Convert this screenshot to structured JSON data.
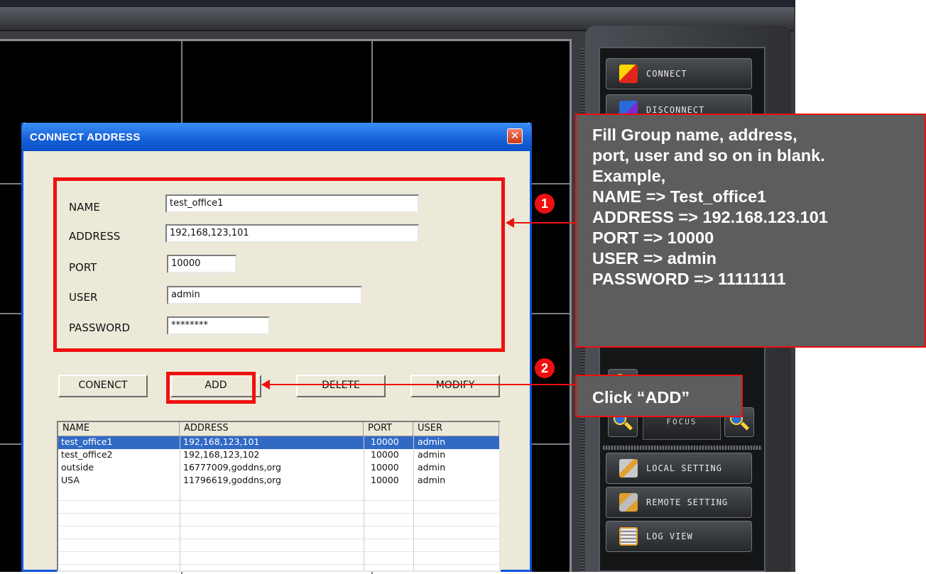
{
  "sidebar": {
    "connect_label": "CONNECT",
    "disconnect_label": "DISCONNECT",
    "focus_label": "FOCUS",
    "local_setting_label": "LOCAL SETTING",
    "remote_setting_label": "REMOTE SETTING",
    "log_view_label": "LOG VIEW"
  },
  "dialog": {
    "title": "CONNECT ADDRESS",
    "close_glyph": "✕",
    "fields": {
      "name_label": "NAME",
      "name_value": "test_office1",
      "address_label": "ADDRESS",
      "address_value": "192,168,123,101",
      "port_label": "PORT",
      "port_value": "10000",
      "user_label": "USER",
      "user_value": "admin",
      "password_label": "PASSWORD",
      "password_value": "********"
    },
    "buttons": {
      "connect": "CONENCT",
      "add": "ADD",
      "delete": "DELETE",
      "modify": "MODIFY"
    },
    "list": {
      "columns": [
        "NAME",
        "ADDRESS",
        "PORT",
        "USER"
      ],
      "rows": [
        {
          "name": "test_office1",
          "address": "192,168,123,101",
          "port": "10000",
          "user": "admin",
          "selected": true
        },
        {
          "name": "test_office2",
          "address": "192,168,123,102",
          "port": "10000",
          "user": "admin",
          "selected": false
        },
        {
          "name": "outside",
          "address": "16777009,goddns,org",
          "port": "10000",
          "user": "admin",
          "selected": false
        },
        {
          "name": "USA",
          "address": "11796619,goddns,org",
          "port": "10000",
          "user": "admin",
          "selected": false
        }
      ]
    }
  },
  "annotations": {
    "step1_badge": "1",
    "step2_badge": "2",
    "callout1_lines": [
      "Fill Group name, address,",
      "port, user and so on in blank.",
      "Example,",
      "NAME => Test_office1",
      "ADDRESS => 192.168.123.101",
      "PORT => 10000",
      "USER => admin",
      "PASSWORD => 11111111"
    ],
    "callout2_text": "Click “ADD”"
  },
  "colors": {
    "highlight_red": "#ee1010",
    "callout_gray": "#5d5d5d",
    "titlebar_blue": "#1460d8",
    "selection_blue": "#316ac5"
  }
}
